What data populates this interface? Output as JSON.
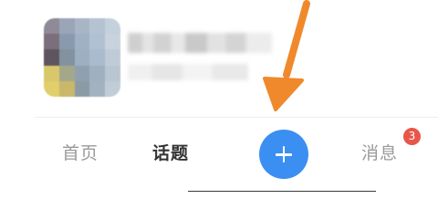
{
  "tabbar": {
    "tabs": [
      {
        "label": "首页",
        "active": false
      },
      {
        "label": "话题",
        "active": true
      },
      {
        "label": "消息",
        "active": false,
        "badge": "3"
      }
    ],
    "publish_icon": "plus-icon"
  },
  "colors": {
    "accent": "#3b8ff2",
    "badge": "#e8564a",
    "arrow": "#f0892b",
    "active_text": "#333333",
    "inactive_text": "#9a9a9a"
  },
  "annotation": {
    "icon": "arrow-icon"
  }
}
